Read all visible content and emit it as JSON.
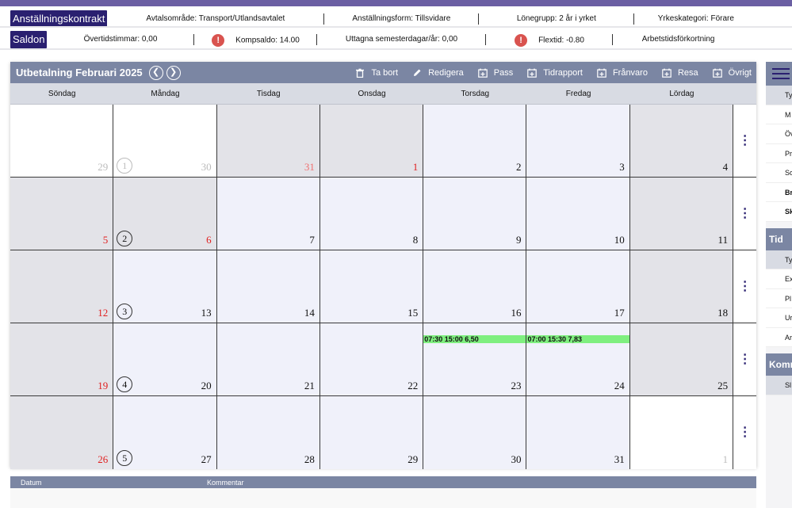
{
  "contract": {
    "title": "Anställningskontrakt",
    "fields": [
      {
        "label": "Avtalsområde: Transport/Utlandsavtalet"
      },
      {
        "label": "Anställningsform: Tillsvidare"
      },
      {
        "label": "Lönegrupp: 2 år i yrket"
      },
      {
        "label": "Yrkeskategori: Förare"
      }
    ]
  },
  "balance": {
    "title": "Saldon",
    "fields": [
      {
        "label": "Övertidstimmar: 0,00"
      },
      {
        "label": "Kompsaldo: 14.00"
      },
      {
        "label": "Uttagna semesterdagar/år: 0,00"
      },
      {
        "label": "Flextid: -0.80"
      },
      {
        "label": "Arbetstidsförkortning"
      }
    ],
    "warn_symbol": "!"
  },
  "calendar": {
    "title": "Utbetalning Februari 2025",
    "prev_icon": "chevron-left-icon",
    "next_icon": "chevron-right-icon",
    "toolbar": [
      {
        "label": "Ta bort",
        "icon": "trash-icon"
      },
      {
        "label": "Redigera",
        "icon": "pencil-icon"
      },
      {
        "label": "Pass",
        "icon": "calendar-plus-icon"
      },
      {
        "label": "Tidrapport",
        "icon": "calendar-plus-icon"
      },
      {
        "label": "Frånvaro",
        "icon": "calendar-plus-icon"
      },
      {
        "label": "Resa",
        "icon": "calendar-plus-icon"
      },
      {
        "label": "Övrigt",
        "icon": "calendar-plus-icon"
      }
    ],
    "weekdays": [
      "Söndag",
      "Måndag",
      "Tisdag",
      "Onsdag",
      "Torsdag",
      "Fredag",
      "Lördag"
    ],
    "weeks": [
      {
        "week": "1",
        "week_faded": true,
        "days": [
          {
            "d": "29",
            "style": "other",
            "num": "faded"
          },
          {
            "d": "30",
            "style": "other",
            "num": "faded"
          },
          {
            "d": "31",
            "style": "gray",
            "num": "fadedred"
          },
          {
            "d": "1",
            "style": "gray",
            "num": "red"
          },
          {
            "d": "2",
            "style": "normal",
            "num": ""
          },
          {
            "d": "3",
            "style": "normal",
            "num": ""
          },
          {
            "d": "4",
            "style": "gray",
            "num": ""
          }
        ]
      },
      {
        "week": "2",
        "week_faded": false,
        "days": [
          {
            "d": "5",
            "style": "gray",
            "num": "red"
          },
          {
            "d": "6",
            "style": "gray",
            "num": "red"
          },
          {
            "d": "7",
            "style": "normal",
            "num": ""
          },
          {
            "d": "8",
            "style": "normal",
            "num": ""
          },
          {
            "d": "9",
            "style": "normal",
            "num": ""
          },
          {
            "d": "10",
            "style": "normal",
            "num": ""
          },
          {
            "d": "11",
            "style": "gray",
            "num": ""
          }
        ]
      },
      {
        "week": "3",
        "week_faded": false,
        "days": [
          {
            "d": "12",
            "style": "gray",
            "num": "red"
          },
          {
            "d": "13",
            "style": "normal",
            "num": ""
          },
          {
            "d": "14",
            "style": "normal",
            "num": ""
          },
          {
            "d": "15",
            "style": "normal",
            "num": ""
          },
          {
            "d": "16",
            "style": "normal",
            "num": ""
          },
          {
            "d": "17",
            "style": "normal",
            "num": ""
          },
          {
            "d": "18",
            "style": "gray",
            "num": ""
          }
        ]
      },
      {
        "week": "4",
        "week_faded": false,
        "days": [
          {
            "d": "19",
            "style": "gray",
            "num": "red"
          },
          {
            "d": "20",
            "style": "normal",
            "num": ""
          },
          {
            "d": "21",
            "style": "normal",
            "num": ""
          },
          {
            "d": "22",
            "style": "normal",
            "num": ""
          },
          {
            "d": "23",
            "style": "normal",
            "num": "",
            "shift": "07:30 15:00 6,50"
          },
          {
            "d": "24",
            "style": "normal",
            "num": "",
            "shift": "07:00 15:30 7,83"
          },
          {
            "d": "25",
            "style": "gray",
            "num": ""
          }
        ]
      },
      {
        "week": "5",
        "week_faded": false,
        "days": [
          {
            "d": "26",
            "style": "gray",
            "num": "red"
          },
          {
            "d": "27",
            "style": "normal",
            "num": ""
          },
          {
            "d": "28",
            "style": "normal",
            "num": ""
          },
          {
            "d": "29",
            "style": "normal",
            "num": ""
          },
          {
            "d": "30",
            "style": "normal",
            "num": ""
          },
          {
            "d": "31",
            "style": "normal",
            "num": ""
          },
          {
            "d": "1",
            "style": "other",
            "num": "faded"
          }
        ]
      }
    ],
    "row_menu_symbol": "⋮"
  },
  "right_panel": {
    "rows1": [
      {
        "label": "Ty",
        "hdr": true
      },
      {
        "label": "M"
      },
      {
        "label": "Öv"
      },
      {
        "label": "Pr"
      },
      {
        "label": "So"
      },
      {
        "label": "Br",
        "bold": true
      },
      {
        "label": "Sk",
        "bold": true
      }
    ],
    "section2": "Tid",
    "rows2": [
      {
        "label": "Ty",
        "hdr": true
      },
      {
        "label": "Ex"
      },
      {
        "label": "Pl"
      },
      {
        "label": "Ur"
      },
      {
        "label": "Ar"
      }
    ],
    "section3": "Komm",
    "rows3": [
      {
        "label": "Sl",
        "hdr": true
      }
    ]
  },
  "bottom": {
    "col_date": "Datum",
    "col_comment": "Kommentar"
  },
  "colors": {
    "accent": "#2a2070",
    "header": "#7b86a3",
    "shift": "#7fef7f",
    "warn": "#d9534f"
  }
}
